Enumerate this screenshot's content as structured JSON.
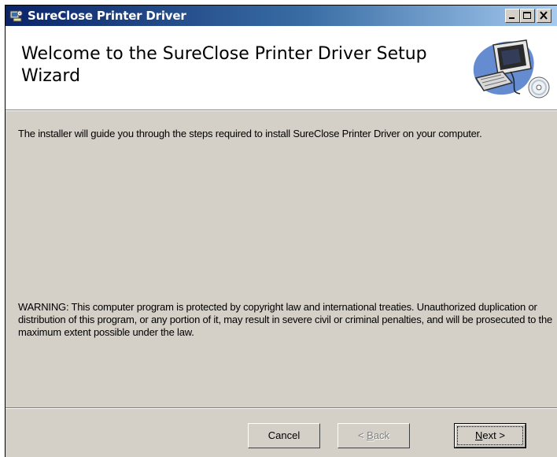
{
  "window": {
    "title": "SureClose Printer Driver",
    "icon": "setup-installer-icon",
    "controls": [
      "minimize-icon",
      "maximize-icon",
      "close-icon"
    ]
  },
  "header": {
    "title": "Welcome to the SureClose Printer Driver Setup Wizard",
    "graphic": "computer-with-cd-icon"
  },
  "body": {
    "intro": "The installer will guide you through the steps required to install SureClose Printer Driver on your computer.",
    "warning": "WARNING: This computer program is protected by copyright law and international treaties. Unauthorized duplication or distribution of this program, or any portion of it, may result in severe civil or criminal penalties, and will be prosecuted to the maximum extent possible under the law."
  },
  "buttons": {
    "cancel": "Cancel",
    "back_prefix": "< ",
    "back_mnemonic": "B",
    "back_rest": "ack",
    "next_mnemonic": "N",
    "next_rest": "ext >"
  },
  "colors": {
    "title_gradient_start": "#0a246a",
    "title_gradient_end": "#a6caf0",
    "dialog_face": "#d4d0c8"
  }
}
